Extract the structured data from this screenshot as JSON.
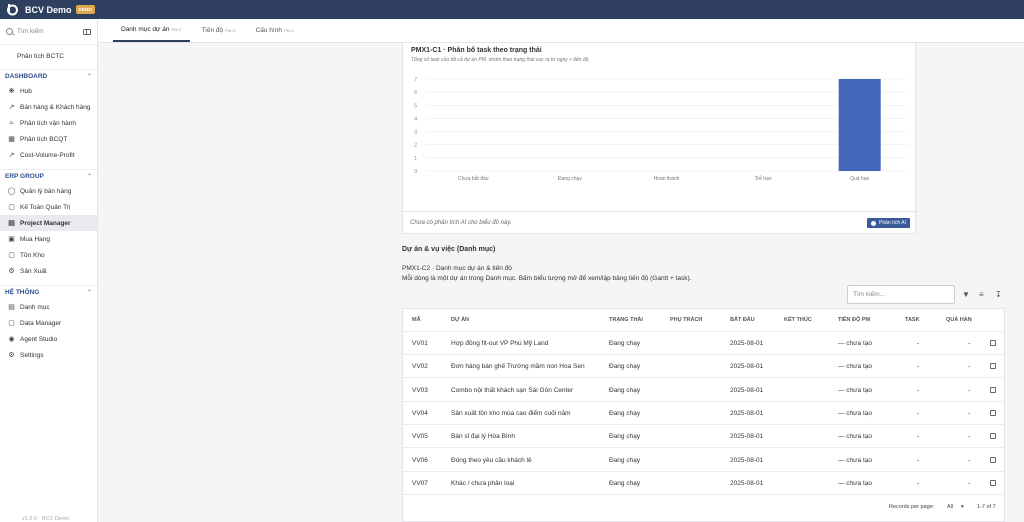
{
  "app": {
    "title": "BCV Demo",
    "badge": "DEMO"
  },
  "sidebar": {
    "search_placeholder": "Tìm kiếm",
    "pinned": "Phân tích BCTC",
    "sections": [
      {
        "title": "DASHBOARD",
        "items": [
          "Hub",
          "Bán hàng & Khách hàng",
          "Phân tích vận hành",
          "Phân tích BCQT",
          "Cost-Volume-Profit"
        ]
      },
      {
        "title": "ERP GROUP",
        "items": [
          "Quản lý bán hàng",
          "Kế Toán Quản Trị",
          "Project Manager",
          "Mua Hang",
          "Tồn Kho",
          "Sản Xuất"
        ]
      },
      {
        "title": "HỆ THỐNG",
        "items": [
          "Danh mục",
          "Data Manager",
          "Agent Studio",
          "Settings"
        ]
      }
    ],
    "version": "v1.0.0 · BCV Demo"
  },
  "tabs": [
    {
      "label": "Danh mục dự án",
      "sub": "PM-C"
    },
    {
      "label": "Tiến độ",
      "sub": "PM-G"
    },
    {
      "label": "Cấu hình",
      "sub": "PM-X"
    }
  ],
  "chart_card": {
    "title": "PMX1-C1 · Phân bố task theo trạng thái",
    "subtitle": "Tổng số task của tất cả dự án PM, nhóm theo trạng thái suy ra từ ngày + tiến độ.",
    "ai_note": "Chưa có phân tích AI cho biểu đồ này.",
    "ai_button": "Phân tích AI"
  },
  "chart_data": {
    "type": "bar",
    "categories": [
      "Chưa bắt đầu",
      "Đang chạy",
      "Hoàn thành",
      "Trễ hạn",
      "Quá hạn"
    ],
    "values": [
      0,
      0,
      0,
      0,
      7
    ],
    "ylim": [
      0,
      7
    ],
    "yticks": [
      0,
      1,
      2,
      3,
      4,
      5,
      6,
      7
    ],
    "color": "#4466bb",
    "grid": true
  },
  "section": {
    "title": "Dự án & vụ việc (Danh mục)",
    "line1": "PMX1-C2 · Danh mục dự án & tiến độ",
    "line2": "Mỗi dòng là một dự án trong Danh mục. Bấm biểu tượng mở để xem/lập bảng tiến độ (Gantt + task)."
  },
  "table": {
    "search_placeholder": "Tìm kiếm...",
    "headers": [
      "MÃ",
      "DỰ ÁN",
      "TRẠNG THÁI",
      "PHỤ TRÁCH",
      "BẮT ĐẦU",
      "KẾT THÚC",
      "TIẾN ĐỘ PM",
      "TASK",
      "QUÁ HẠN"
    ],
    "rows": [
      [
        "VV01",
        "Hợp đồng fit-out VP Phú Mỹ Land",
        "Đang chạy",
        "",
        "2025-08-01",
        "",
        "— chưa tạo",
        "-",
        "-"
      ],
      [
        "VV02",
        "Đơn hàng bàn ghế Trường mầm non Hoa Sen",
        "Đang chạy",
        "",
        "2025-08-01",
        "",
        "— chưa tạo",
        "-",
        "-"
      ],
      [
        "VV03",
        "Combo nội thất khách sạn Sài Gòn Center",
        "Đang chạy",
        "",
        "2025-08-01",
        "",
        "— chưa tạo",
        "-",
        "-"
      ],
      [
        "VV04",
        "Sản xuất tồn kho mùa cao điểm cuối năm",
        "Đang chạy",
        "",
        "2025-08-01",
        "",
        "— chưa tạo",
        "-",
        "-"
      ],
      [
        "VV05",
        "Bán sỉ đại lý Hòa Bình",
        "Đang chạy",
        "",
        "2025-08-01",
        "",
        "— chưa tạo",
        "-",
        "-"
      ],
      [
        "VV06",
        "Đóng theo yêu cầu khách lẻ",
        "Đang chạy",
        "",
        "2025-08-01",
        "",
        "— chưa tạo",
        "-",
        "-"
      ],
      [
        "VV07",
        "Khác / chưa phân loại",
        "Đang chạy",
        "",
        "2025-08-01",
        "",
        "— chưa tạo",
        "-",
        "-"
      ]
    ],
    "rows_per_page_label": "Records per page:",
    "rows_per_page_value": "All",
    "pagination": "1-7 of 7"
  },
  "icons": {
    "filter": "filter-icon",
    "columns": "columns-icon",
    "download": "download-icon",
    "edit": "open-icon"
  }
}
